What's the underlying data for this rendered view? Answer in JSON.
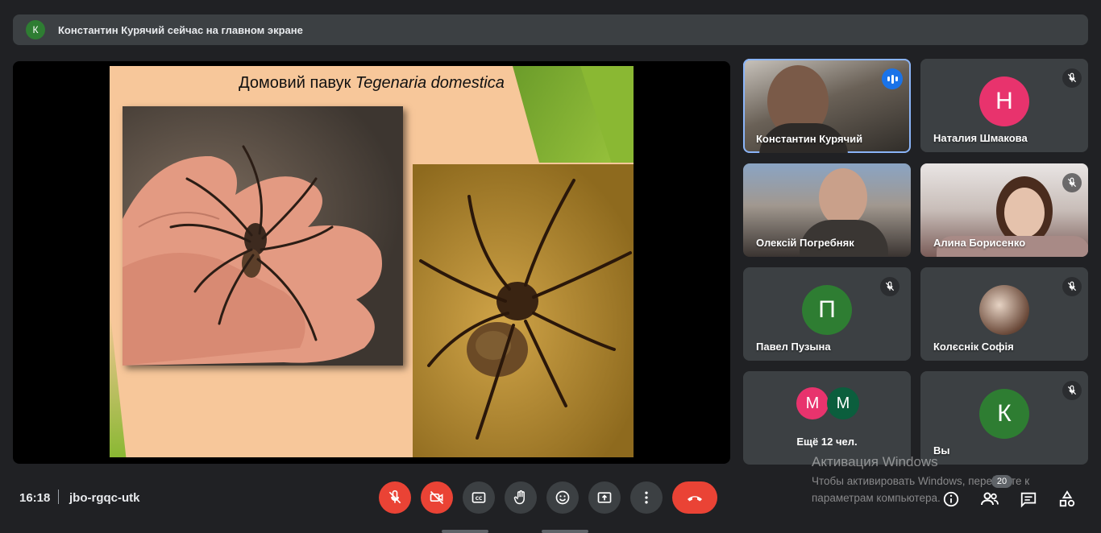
{
  "banner": {
    "avatar_letter": "К",
    "avatar_color": "#2e7d32",
    "text": "Константин Курячий сейчас на главном экране"
  },
  "slide": {
    "title_plain": "Домовий павук ",
    "title_italic": "Tegenaria domestica"
  },
  "participants": [
    {
      "name": "Константин Курячий",
      "video": true,
      "speaking": true
    },
    {
      "name": "Наталия Шмакова",
      "letter": "Н",
      "color": "#e8336d",
      "muted": true
    },
    {
      "name": "Олексій Погребняк",
      "video": true
    },
    {
      "name": "Алина Борисенко",
      "video": true,
      "muted": true
    },
    {
      "name": "Павел Пузына",
      "letter": "П",
      "color": "#2e7d32",
      "muted": true
    },
    {
      "name": "Колєснік Софія",
      "photo": true,
      "muted": true
    },
    {
      "name": "Ещё 12 чел.",
      "letters": [
        "М",
        "М"
      ],
      "colors": [
        "#e8336d",
        "#0b5e3d"
      ]
    },
    {
      "name": "Вы",
      "letter": "К",
      "color": "#2e7d32",
      "muted": true
    }
  ],
  "bottom": {
    "time": "16:18",
    "meeting_code": "jbo-rgqc-utk",
    "participant_count": "20"
  },
  "watermark": {
    "line1": "Активация Windows",
    "line2": "Чтобы активировать Windows, перейдите к параметрам компьютера."
  },
  "colors": {
    "accent": "#8ab4f8",
    "danger": "#ea4335",
    "surface": "#3c4043",
    "background": "#202124"
  }
}
